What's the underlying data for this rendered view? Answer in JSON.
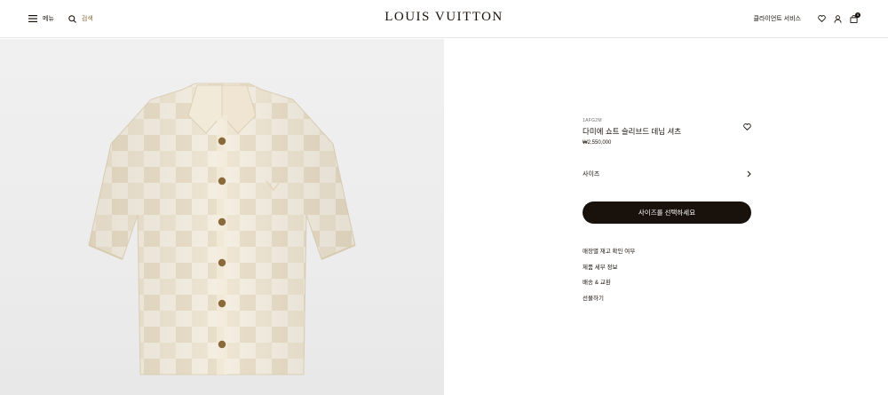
{
  "header": {
    "menu_label": "메뉴",
    "search_label": "검색",
    "brand": "LOUIS VUITTON",
    "contact_label": "클라이언트 서비스",
    "icons": [
      "menu-icon",
      "search-icon",
      "heart-icon",
      "account-icon",
      "shopping-bag-icon"
    ],
    "bag_count": "0"
  },
  "gallery": {
    "image_alt": "cream checkered short-sleeve denim shirt",
    "colors": {
      "fabric": "#ede3cf",
      "fabric_light": "#f5efe2",
      "buttons": "#8a6a3a",
      "background": "#ededed"
    }
  },
  "product": {
    "sku": "1AFG2M",
    "name": "다미에 쇼트 슬리브드 데님 셔츠",
    "price": "₩2,550,000",
    "size_label": "사이즈",
    "cta_label": "사이즈를 선택하세요",
    "links": [
      "매장별 재고 확인 여부",
      "제품 세부 정보",
      "배송 & 교환",
      "선물하기"
    ]
  },
  "colors": {
    "text": "#19110b",
    "button_bg": "#19110b",
    "button_text": "#ffffff",
    "border": "#e6e6e6"
  }
}
